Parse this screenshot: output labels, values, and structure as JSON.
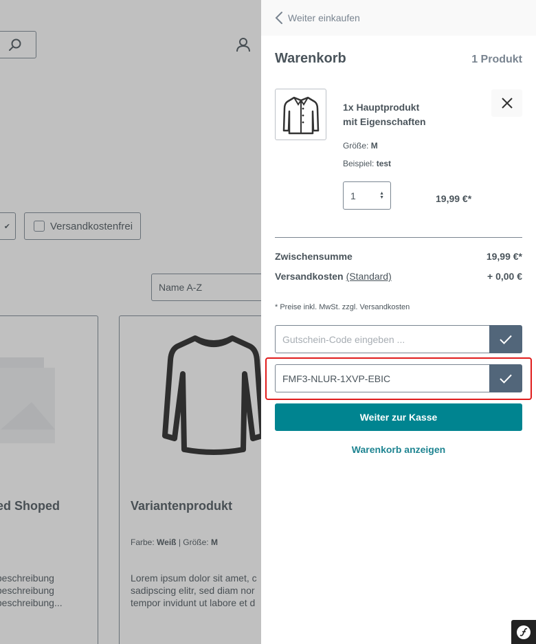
{
  "shop": {
    "sort_value": "Name A-Z",
    "filter_shipping_free": "Versandkostenfrei",
    "products": [
      {
        "title": "ted Shoped",
        "desc_lines": [
          "tbeschreibung",
          "tbeschreibung",
          "tbeschreibung..."
        ]
      },
      {
        "title": "Variantenprodukt",
        "prop1_label": "Farbe:",
        "prop1_value": "Weiß",
        "prop_sep": "|",
        "prop2_label": "Größe:",
        "prop2_value": "M",
        "desc_lines": [
          "Lorem ipsum dolor sit amet, c",
          "sadipscing elitr, sed diam nor",
          "tempor invidunt ut labore et d"
        ]
      }
    ]
  },
  "cart": {
    "back_label": "Weiter einkaufen",
    "title": "Warenkorb",
    "count": "1 Produkt",
    "item": {
      "name_line1": "1x Hauptprodukt",
      "name_line2": "mit Eigenschaften",
      "prop1_label": "Größe:",
      "prop1_value": "M",
      "prop2_label": "Beispiel:",
      "prop2_value": "test",
      "quantity": "1",
      "price": "19,99 €*"
    },
    "subtotal_label": "Zwischensumme",
    "subtotal_value": "19,99 €*",
    "shipping_label": "Versandkosten",
    "shipping_method": "(Standard)",
    "shipping_value": "+ 0,00 €",
    "tax_note": "* Preise inkl. MwSt. zzgl. Versandkosten",
    "voucher_placeholder": "Gutschein-Code eingeben ...",
    "voucher_code": "FMF3-NLUR-1XVP-EBIC",
    "checkout_label": "Weiter zur Kasse",
    "show_cart_label": "Warenkorb anzeigen"
  },
  "colors": {
    "primary": "#008490",
    "apply_button": "#52667a",
    "highlight": "#e01b1b",
    "text": "#4a545b"
  }
}
